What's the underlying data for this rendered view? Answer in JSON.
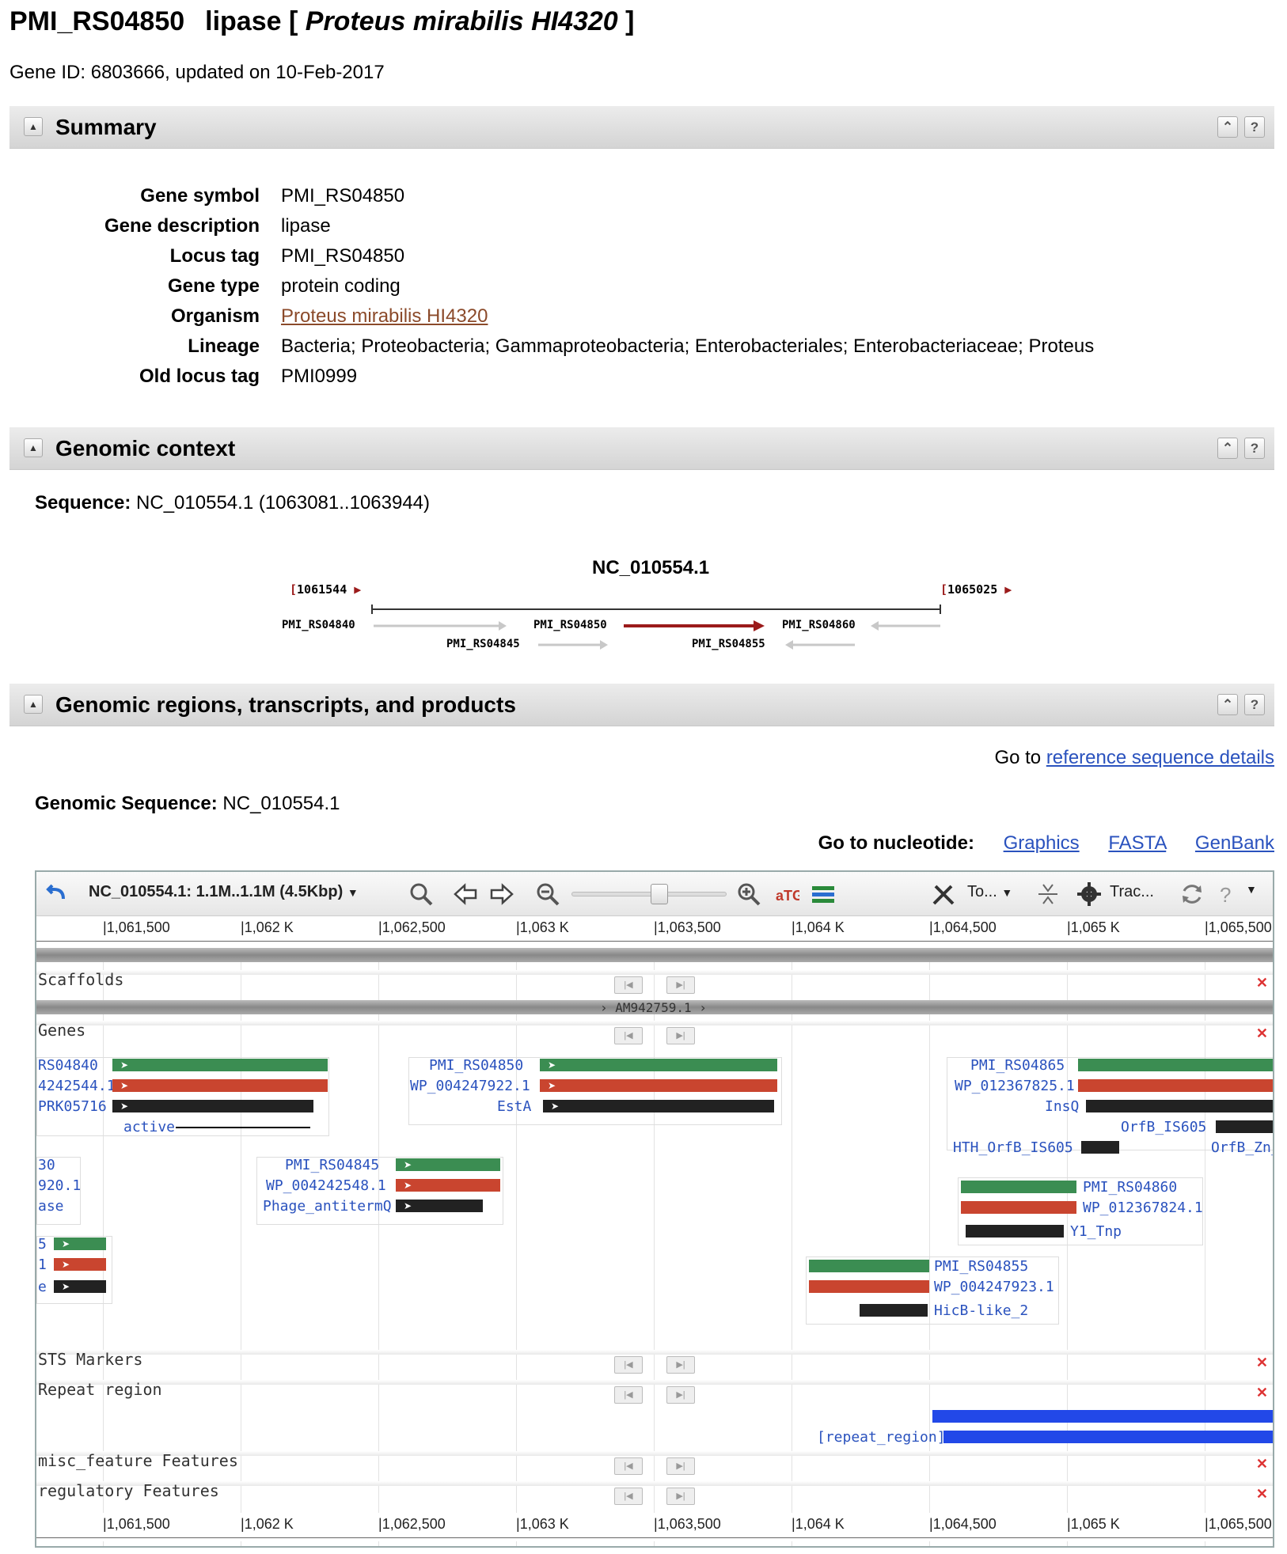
{
  "header": {
    "gene_id_name": "PMI_RS04850",
    "gene_desc": "lipase",
    "bracket_open": "[",
    "organism": "Proteus mirabilis HI4320",
    "bracket_close": "]",
    "gene_info": "Gene ID: 6803666, updated on 10-Feb-2017"
  },
  "sections": {
    "summary": "Summary",
    "genomic_context": "Genomic context",
    "regions": "Genomic regions, transcripts, and products"
  },
  "section_buttons": {
    "collapse": "⌃",
    "help": "?"
  },
  "summary": [
    {
      "term": "Gene symbol",
      "value": "PMI_RS04850"
    },
    {
      "term": "Gene description",
      "value": "lipase"
    },
    {
      "term": "Locus tag",
      "value": "PMI_RS04850"
    },
    {
      "term": "Gene type",
      "value": "protein coding"
    },
    {
      "term": "Organism",
      "value": "Proteus mirabilis HI4320"
    },
    {
      "term": "Lineage",
      "value": "Bacteria; Proteobacteria; Gammaproteobacteria; Enterobacteriales; Enterobacteriaceae; Proteus"
    },
    {
      "term": "Old locus tag",
      "value": "PMI0999"
    }
  ],
  "context": {
    "sequence_label": "Sequence:",
    "sequence_value": "NC_010554.1 (1063081..1063944)",
    "map_title": "NC_010554.1",
    "left_coord": "1061544",
    "right_coord": "1065025",
    "genes": {
      "g4840": "PMI_RS04840",
      "g4845": "PMI_RS04845",
      "g4850": "PMI_RS04850",
      "g4855": "PMI_RS04855",
      "g4860": "PMI_RS04860"
    }
  },
  "regions": {
    "goto_prefix": "Go to",
    "goto_link": "reference sequence details",
    "genomic_seq_label": "Genomic Sequence:",
    "genomic_seq_value": "NC_010554.1",
    "nuc_label": "Go to nucleotide:",
    "nuc_links": [
      "Graphics",
      "FASTA",
      "GenBank"
    ]
  },
  "viewer": {
    "location": "NC_010554.1: 1.1M..1.1M (4.5Kbp)",
    "tools_label": "To...",
    "tracks_label": "Trac...",
    "ruler_ticks": [
      "1,061,500",
      "1,062 K",
      "1,062,500",
      "1,063 K",
      "1,063,500",
      "1,064 K",
      "1,064,500",
      "1,065 K",
      "1,065,500"
    ],
    "tracks": [
      "Scaffolds",
      "Genes",
      "STS Markers",
      "Repeat region",
      "misc_feature Features",
      "regulatory Features"
    ],
    "scaffold_name": "AM942759.1",
    "features": {
      "f1a": "RS04840",
      "f1b": "4242544.1",
      "f1c": "PRK05716",
      "f1d": "active",
      "f2a": "PMI_RS04850",
      "f2b": "WP_004247922.1",
      "f2c": "EstA",
      "f3a": "PMI_RS04865",
      "f3b": "WP_012367825.1",
      "f3c": "InsQ",
      "f3d": "OrfB_IS605",
      "f3e": "HTH_OrfB_IS605",
      "f3f": "OrfB_Zn_",
      "f4a": "30",
      "f4b": "920.1",
      "f4c": "ase",
      "f5a": "PMI_RS04845",
      "f5b": "WP_004242548.1",
      "f5c": "Phage_antitermQ",
      "f6a": "PMI_RS04860",
      "f6b": "WP_012367824.1",
      "f6c": "Y1_Tnp",
      "f7a": "5",
      "f7b": "1",
      "f7c": "e",
      "f8a": "PMI_RS04855",
      "f8b": "WP_004247923.1",
      "f8c": "HicB-like_2",
      "repeat": "[repeat_region]"
    }
  },
  "colors": {
    "gene_green": "#3b8d52",
    "protein_red": "#c9452f",
    "domain_black": "#222222",
    "repeat_blue": "#2248e8",
    "context_red": "#9b1b1b",
    "organism_link": "#8b4a2a",
    "link_blue": "#2a52be"
  }
}
